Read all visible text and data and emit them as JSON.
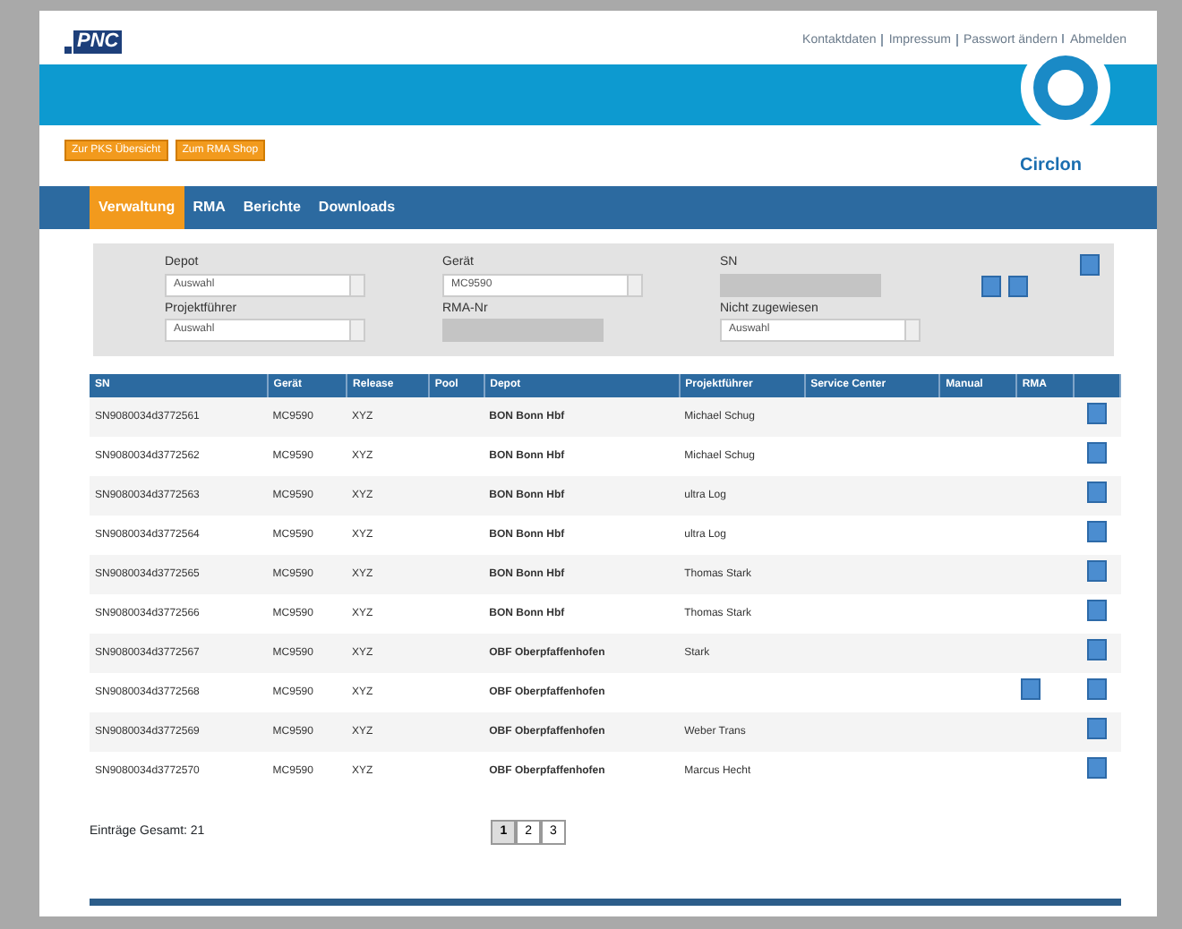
{
  "header": {
    "logo": "PNC",
    "links": [
      "Kontaktdaten",
      "Impressum",
      "Passwort ändern",
      "Abmelden"
    ],
    "buttons": [
      "Zur PKS Übersicht",
      "Zum RMA Shop"
    ],
    "brand": "Circlon"
  },
  "tabs": [
    {
      "label": "Verwaltung",
      "selected": true
    },
    {
      "label": "RMA",
      "selected": false
    },
    {
      "label": "Berichte",
      "selected": false
    },
    {
      "label": "Downloads",
      "selected": false
    }
  ],
  "filters": [
    {
      "label": "Depot",
      "value": "Auswahl",
      "kind": "select",
      "disabled": false
    },
    {
      "label": "Gerät",
      "value": "MC9590",
      "kind": "select",
      "disabled": false
    },
    {
      "label": "SN",
      "kind": "text",
      "disabled": true
    },
    {
      "label": "Projektführer",
      "value": "Auswahl",
      "kind": "select",
      "disabled": false
    },
    {
      "label": "RMA-Nr",
      "kind": "text",
      "disabled": true
    },
    {
      "label": "Nicht zugewiesen",
      "value": "Auswahl",
      "kind": "select",
      "disabled": false
    }
  ],
  "table": {
    "columns": [
      "SN",
      "Gerät",
      "Release",
      "Pool",
      "Depot",
      "Projektführer",
      "Service Center",
      "Manual",
      "RMA"
    ],
    "rows": [
      {
        "sn": "SN9080034d3772561",
        "device": "MC9590",
        "release": "XYZ",
        "depot": "BON Bonn Hbf",
        "lead": "Michael Schug",
        "rma": false
      },
      {
        "sn": "SN9080034d3772562",
        "device": "MC9590",
        "release": "XYZ",
        "depot": "BON Bonn Hbf",
        "lead": "Michael Schug",
        "rma": false
      },
      {
        "sn": "SN9080034d3772563",
        "device": "MC9590",
        "release": "XYZ",
        "depot": "BON Bonn Hbf",
        "lead": "ultra Log",
        "rma": false
      },
      {
        "sn": "SN9080034d3772564",
        "device": "MC9590",
        "release": "XYZ",
        "depot": "BON Bonn Hbf",
        "lead": "ultra Log",
        "rma": false
      },
      {
        "sn": "SN9080034d3772565",
        "device": "MC9590",
        "release": "XYZ",
        "depot": "BON Bonn Hbf",
        "lead": "Thomas Stark",
        "rma": false
      },
      {
        "sn": "SN9080034d3772566",
        "device": "MC9590",
        "release": "XYZ",
        "depot": "BON Bonn Hbf",
        "lead": "Thomas Stark",
        "rma": false
      },
      {
        "sn": "SN9080034d3772567",
        "device": "MC9590",
        "release": "XYZ",
        "depot": "OBF Oberpfaffenhofen",
        "lead": "Stark",
        "rma": false
      },
      {
        "sn": "SN9080034d3772568",
        "device": "MC9590",
        "release": "XYZ",
        "depot": "OBF Oberpfaffenhofen",
        "rma": true
      },
      {
        "sn": "SN9080034d3772569",
        "device": "MC9590",
        "release": "XYZ",
        "depot": "OBF Oberpfaffenhofen",
        "lead": "Weber Trans",
        "rma": false
      },
      {
        "sn": "SN9080034d3772570",
        "device": "MC9590",
        "release": "XYZ",
        "depot": "OBF Oberpfaffenhofen",
        "lead": "Marcus Hecht",
        "rma": false
      }
    ]
  },
  "total": "Einträge Gesamt: 21",
  "pages": [
    {
      "label": "1",
      "selected": true
    },
    {
      "label": "2",
      "selected": false
    },
    {
      "label": "3",
      "selected": false
    }
  ]
}
